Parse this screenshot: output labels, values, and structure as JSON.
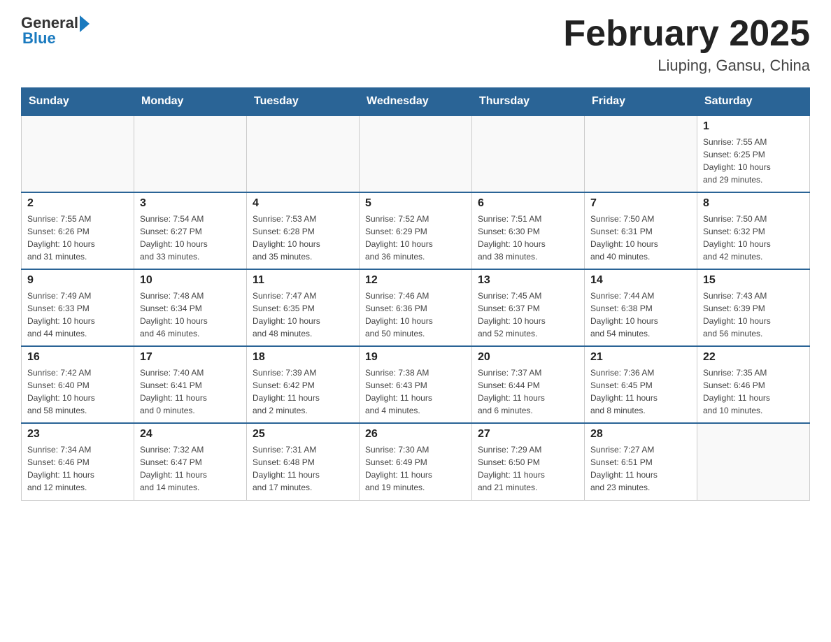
{
  "header": {
    "logo_general": "General",
    "logo_blue": "Blue",
    "title": "February 2025",
    "subtitle": "Liuping, Gansu, China"
  },
  "weekdays": [
    "Sunday",
    "Monday",
    "Tuesday",
    "Wednesday",
    "Thursday",
    "Friday",
    "Saturday"
  ],
  "weeks": [
    [
      {
        "day": "",
        "info": ""
      },
      {
        "day": "",
        "info": ""
      },
      {
        "day": "",
        "info": ""
      },
      {
        "day": "",
        "info": ""
      },
      {
        "day": "",
        "info": ""
      },
      {
        "day": "",
        "info": ""
      },
      {
        "day": "1",
        "info": "Sunrise: 7:55 AM\nSunset: 6:25 PM\nDaylight: 10 hours\nand 29 minutes."
      }
    ],
    [
      {
        "day": "2",
        "info": "Sunrise: 7:55 AM\nSunset: 6:26 PM\nDaylight: 10 hours\nand 31 minutes."
      },
      {
        "day": "3",
        "info": "Sunrise: 7:54 AM\nSunset: 6:27 PM\nDaylight: 10 hours\nand 33 minutes."
      },
      {
        "day": "4",
        "info": "Sunrise: 7:53 AM\nSunset: 6:28 PM\nDaylight: 10 hours\nand 35 minutes."
      },
      {
        "day": "5",
        "info": "Sunrise: 7:52 AM\nSunset: 6:29 PM\nDaylight: 10 hours\nand 36 minutes."
      },
      {
        "day": "6",
        "info": "Sunrise: 7:51 AM\nSunset: 6:30 PM\nDaylight: 10 hours\nand 38 minutes."
      },
      {
        "day": "7",
        "info": "Sunrise: 7:50 AM\nSunset: 6:31 PM\nDaylight: 10 hours\nand 40 minutes."
      },
      {
        "day": "8",
        "info": "Sunrise: 7:50 AM\nSunset: 6:32 PM\nDaylight: 10 hours\nand 42 minutes."
      }
    ],
    [
      {
        "day": "9",
        "info": "Sunrise: 7:49 AM\nSunset: 6:33 PM\nDaylight: 10 hours\nand 44 minutes."
      },
      {
        "day": "10",
        "info": "Sunrise: 7:48 AM\nSunset: 6:34 PM\nDaylight: 10 hours\nand 46 minutes."
      },
      {
        "day": "11",
        "info": "Sunrise: 7:47 AM\nSunset: 6:35 PM\nDaylight: 10 hours\nand 48 minutes."
      },
      {
        "day": "12",
        "info": "Sunrise: 7:46 AM\nSunset: 6:36 PM\nDaylight: 10 hours\nand 50 minutes."
      },
      {
        "day": "13",
        "info": "Sunrise: 7:45 AM\nSunset: 6:37 PM\nDaylight: 10 hours\nand 52 minutes."
      },
      {
        "day": "14",
        "info": "Sunrise: 7:44 AM\nSunset: 6:38 PM\nDaylight: 10 hours\nand 54 minutes."
      },
      {
        "day": "15",
        "info": "Sunrise: 7:43 AM\nSunset: 6:39 PM\nDaylight: 10 hours\nand 56 minutes."
      }
    ],
    [
      {
        "day": "16",
        "info": "Sunrise: 7:42 AM\nSunset: 6:40 PM\nDaylight: 10 hours\nand 58 minutes."
      },
      {
        "day": "17",
        "info": "Sunrise: 7:40 AM\nSunset: 6:41 PM\nDaylight: 11 hours\nand 0 minutes."
      },
      {
        "day": "18",
        "info": "Sunrise: 7:39 AM\nSunset: 6:42 PM\nDaylight: 11 hours\nand 2 minutes."
      },
      {
        "day": "19",
        "info": "Sunrise: 7:38 AM\nSunset: 6:43 PM\nDaylight: 11 hours\nand 4 minutes."
      },
      {
        "day": "20",
        "info": "Sunrise: 7:37 AM\nSunset: 6:44 PM\nDaylight: 11 hours\nand 6 minutes."
      },
      {
        "day": "21",
        "info": "Sunrise: 7:36 AM\nSunset: 6:45 PM\nDaylight: 11 hours\nand 8 minutes."
      },
      {
        "day": "22",
        "info": "Sunrise: 7:35 AM\nSunset: 6:46 PM\nDaylight: 11 hours\nand 10 minutes."
      }
    ],
    [
      {
        "day": "23",
        "info": "Sunrise: 7:34 AM\nSunset: 6:46 PM\nDaylight: 11 hours\nand 12 minutes."
      },
      {
        "day": "24",
        "info": "Sunrise: 7:32 AM\nSunset: 6:47 PM\nDaylight: 11 hours\nand 14 minutes."
      },
      {
        "day": "25",
        "info": "Sunrise: 7:31 AM\nSunset: 6:48 PM\nDaylight: 11 hours\nand 17 minutes."
      },
      {
        "day": "26",
        "info": "Sunrise: 7:30 AM\nSunset: 6:49 PM\nDaylight: 11 hours\nand 19 minutes."
      },
      {
        "day": "27",
        "info": "Sunrise: 7:29 AM\nSunset: 6:50 PM\nDaylight: 11 hours\nand 21 minutes."
      },
      {
        "day": "28",
        "info": "Sunrise: 7:27 AM\nSunset: 6:51 PM\nDaylight: 11 hours\nand 23 minutes."
      },
      {
        "day": "",
        "info": ""
      }
    ]
  ]
}
